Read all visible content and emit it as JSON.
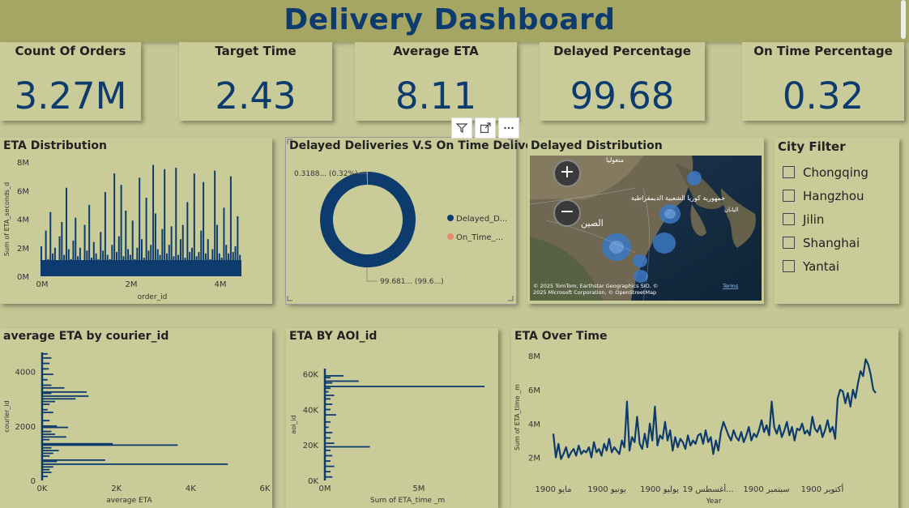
{
  "header": {
    "title": "Delivery Dashboard"
  },
  "kpis": [
    {
      "label": "Count Of Orders",
      "value": "3.27M"
    },
    {
      "label": "Target Time",
      "value": "2.43"
    },
    {
      "label": "Average ETA",
      "value": "8.11"
    },
    {
      "label": "Delayed Percentage",
      "value": "99.68"
    },
    {
      "label": "On Time Percentage",
      "value": "0.32"
    }
  ],
  "colors": {
    "background": "#c4c896",
    "header": "#a5a564",
    "series": "#0d3b6e",
    "on_time": "#e58a6b"
  },
  "city_filter": {
    "title": "City Filter",
    "cities": [
      "Chongqing",
      "Hangzhou",
      "Jilin",
      "Shanghai",
      "Yantai"
    ]
  },
  "map": {
    "title": "Delayed Distribution",
    "attribution_line1": "© 2025 TomTom, Earthstar Geographics SIO, ©",
    "attribution_terms": "Terms",
    "attribution_line2": "2025 Microsoft Corporation, © OpenStreetMap",
    "labels": [
      "منغوليا",
      "جمهورية كوريا الشعبية الديمقراطية",
      "اليابان",
      "الصين"
    ]
  },
  "chart_data": [
    {
      "type": "bar",
      "title": "ETA Distribution",
      "xlabel": "order_id",
      "ylabel": "Sum of ETA_seconds_d",
      "xticks": [
        "0M",
        "2M",
        "4M"
      ],
      "yticks": [
        "0M",
        "2M",
        "4M",
        "6M",
        "8M"
      ],
      "xlim": [
        0,
        4.5
      ],
      "ylim": [
        0,
        8
      ],
      "values": [
        2.1,
        1.0,
        3.2,
        1.2,
        4.5,
        1.6,
        2.0,
        1.1,
        2.8,
        3.8,
        1.5,
        6.2,
        1.9,
        1.2,
        2.5,
        4.1,
        1.4,
        2.0,
        1.1,
        3.6,
        1.8,
        5.0,
        1.3,
        2.4,
        1.6,
        1.2,
        3.1,
        1.8,
        5.9,
        1.5,
        1.2,
        2.2,
        7.2,
        1.7,
        2.8,
        6.4,
        1.4,
        4.6,
        1.9,
        1.5,
        3.9,
        1.2,
        2.0,
        6.9,
        2.6,
        1.3,
        5.5,
        1.8,
        2.2,
        7.8,
        4.4,
        1.9,
        1.5,
        3.3,
        7.5,
        1.6,
        2.2,
        3.5,
        1.4,
        7.6,
        1.5,
        2.6,
        3.6,
        1.3,
        5.2,
        1.7,
        2.0,
        7.2,
        1.4,
        1.7,
        3.2,
        6.6,
        1.6,
        2.6,
        1.2,
        1.9,
        7.4,
        3.6,
        1.6,
        1.3,
        4.8,
        2.2,
        1.6,
        7.0,
        1.7,
        2.1,
        4.2,
        1.5
      ]
    },
    {
      "type": "pie",
      "title": "Delayed Deliveries V.S On Time Delivery",
      "series": [
        {
          "name": "Delayed_D...",
          "value": 99.68,
          "label": "99.681... (99.6...)"
        },
        {
          "name": "On_Time_...",
          "value": 0.32,
          "label": "0.3188... (0.32%)"
        }
      ]
    },
    {
      "type": "bar",
      "orientation": "horizontal",
      "title": "average ETA by courier_id",
      "xlabel": "average ETA",
      "ylabel": "courier_id",
      "xticks": [
        "0K",
        "2K",
        "4K",
        "6K"
      ],
      "yticks": [
        "0",
        "2000",
        "4000"
      ],
      "xlim": [
        0,
        6000
      ],
      "ylim": [
        0,
        4700
      ],
      "bars": [
        [
          4650,
          150
        ],
        [
          4500,
          250
        ],
        [
          4300,
          200
        ],
        [
          4100,
          180
        ],
        [
          3900,
          300
        ],
        [
          3700,
          150
        ],
        [
          3500,
          250
        ],
        [
          3400,
          600
        ],
        [
          3250,
          1200
        ],
        [
          3200,
          250
        ],
        [
          3100,
          1250
        ],
        [
          3000,
          900
        ],
        [
          2900,
          350
        ],
        [
          2800,
          200
        ],
        [
          2600,
          150
        ],
        [
          2500,
          300
        ],
        [
          2200,
          200
        ],
        [
          2000,
          400
        ],
        [
          1950,
          700
        ],
        [
          1800,
          250
        ],
        [
          1700,
          350
        ],
        [
          1600,
          650
        ],
        [
          1500,
          200
        ],
        [
          1350,
          1900
        ],
        [
          1300,
          3650
        ],
        [
          1200,
          250
        ],
        [
          1100,
          450
        ],
        [
          1000,
          300
        ],
        [
          900,
          200
        ],
        [
          750,
          1700
        ],
        [
          700,
          400
        ],
        [
          600,
          5000
        ],
        [
          500,
          300
        ],
        [
          400,
          200
        ],
        [
          300,
          250
        ],
        [
          150,
          150
        ]
      ]
    },
    {
      "type": "bar",
      "orientation": "horizontal",
      "title": "ETA BY AOI_id",
      "xlabel": "Sum of ETA_time _m",
      "ylabel": "aoi_id",
      "xticks": [
        "0M",
        "5M"
      ],
      "yticks": [
        "0K",
        "20K",
        "40K",
        "60K"
      ],
      "xlim": [
        0,
        8.5
      ],
      "ylim": [
        0,
        63000
      ],
      "bars": [
        [
          59000,
          1.0
        ],
        [
          58000,
          0.3
        ],
        [
          56000,
          1.8
        ],
        [
          55000,
          0.4
        ],
        [
          53000,
          8.5
        ],
        [
          52000,
          0.3
        ],
        [
          50000,
          0.2
        ],
        [
          48000,
          0.5
        ],
        [
          46000,
          0.3
        ],
        [
          43000,
          0.4
        ],
        [
          40000,
          0.3
        ],
        [
          37000,
          0.6
        ],
        [
          33000,
          0.3
        ],
        [
          30000,
          0.2
        ],
        [
          27000,
          0.4
        ],
        [
          24000,
          0.3
        ],
        [
          21000,
          0.5
        ],
        [
          19000,
          2.4
        ],
        [
          17000,
          0.3
        ],
        [
          14000,
          0.4
        ],
        [
          11000,
          0.3
        ],
        [
          8000,
          0.5
        ],
        [
          5000,
          0.3
        ],
        [
          2000,
          0.4
        ]
      ]
    },
    {
      "type": "line",
      "title": "ETA Over Time",
      "xlabel": "Year",
      "ylabel": "Sum of ETA_time _m",
      "xticks": [
        "مايو 1900",
        "يونيو 1900",
        "يوليو 1900",
        "أغسطس 19...",
        "سبتمبر 1900",
        "أكتوبر 1900"
      ],
      "yticks": [
        "2M",
        "4M",
        "6M",
        "8M"
      ],
      "ylim": [
        1.5,
        8.2
      ],
      "values": [
        3.4,
        2.0,
        2.8,
        1.9,
        2.2,
        2.6,
        2.0,
        2.3,
        2.5,
        2.1,
        2.7,
        2.2,
        2.4,
        2.3,
        2.6,
        2.0,
        2.9,
        2.3,
        2.5,
        2.1,
        2.8,
        2.4,
        3.1,
        2.3,
        2.6,
        2.4,
        2.2,
        3.0,
        2.6,
        5.3,
        2.4,
        3.2,
        2.9,
        4.4,
        2.8,
        2.5,
        3.4,
        2.6,
        4.0,
        3.0,
        5.0,
        2.7,
        3.3,
        3.1,
        4.1,
        3.0,
        3.6,
        2.4,
        3.2,
        2.6,
        3.1,
        2.9,
        2.5,
        3.3,
        2.7,
        3.0,
        2.8,
        3.3,
        3.4,
        2.8,
        3.6,
        2.9,
        3.2,
        2.2,
        3.0,
        2.4,
        3.5,
        4.1,
        3.7,
        3.3,
        3.0,
        3.6,
        3.2,
        3.0,
        3.5,
        2.9,
        3.3,
        3.8,
        3.0,
        3.4,
        3.2,
        3.6,
        4.2,
        3.5,
        3.9,
        3.3,
        5.3,
        3.8,
        3.4,
        3.9,
        3.2,
        3.6,
        4.1,
        3.3,
        3.8,
        3.0,
        3.7,
        3.6,
        4.0,
        3.4,
        3.6,
        3.3,
        4.4,
        3.7,
        3.5,
        3.9,
        3.2,
        3.6,
        4.2,
        3.5,
        3.8,
        3.1,
        5.5,
        6.0,
        5.9,
        5.2,
        5.8,
        5.0,
        6.0,
        5.5,
        6.4,
        7.1,
        6.8,
        7.8,
        7.5,
        6.9,
        6.0,
        5.8
      ]
    }
  ]
}
